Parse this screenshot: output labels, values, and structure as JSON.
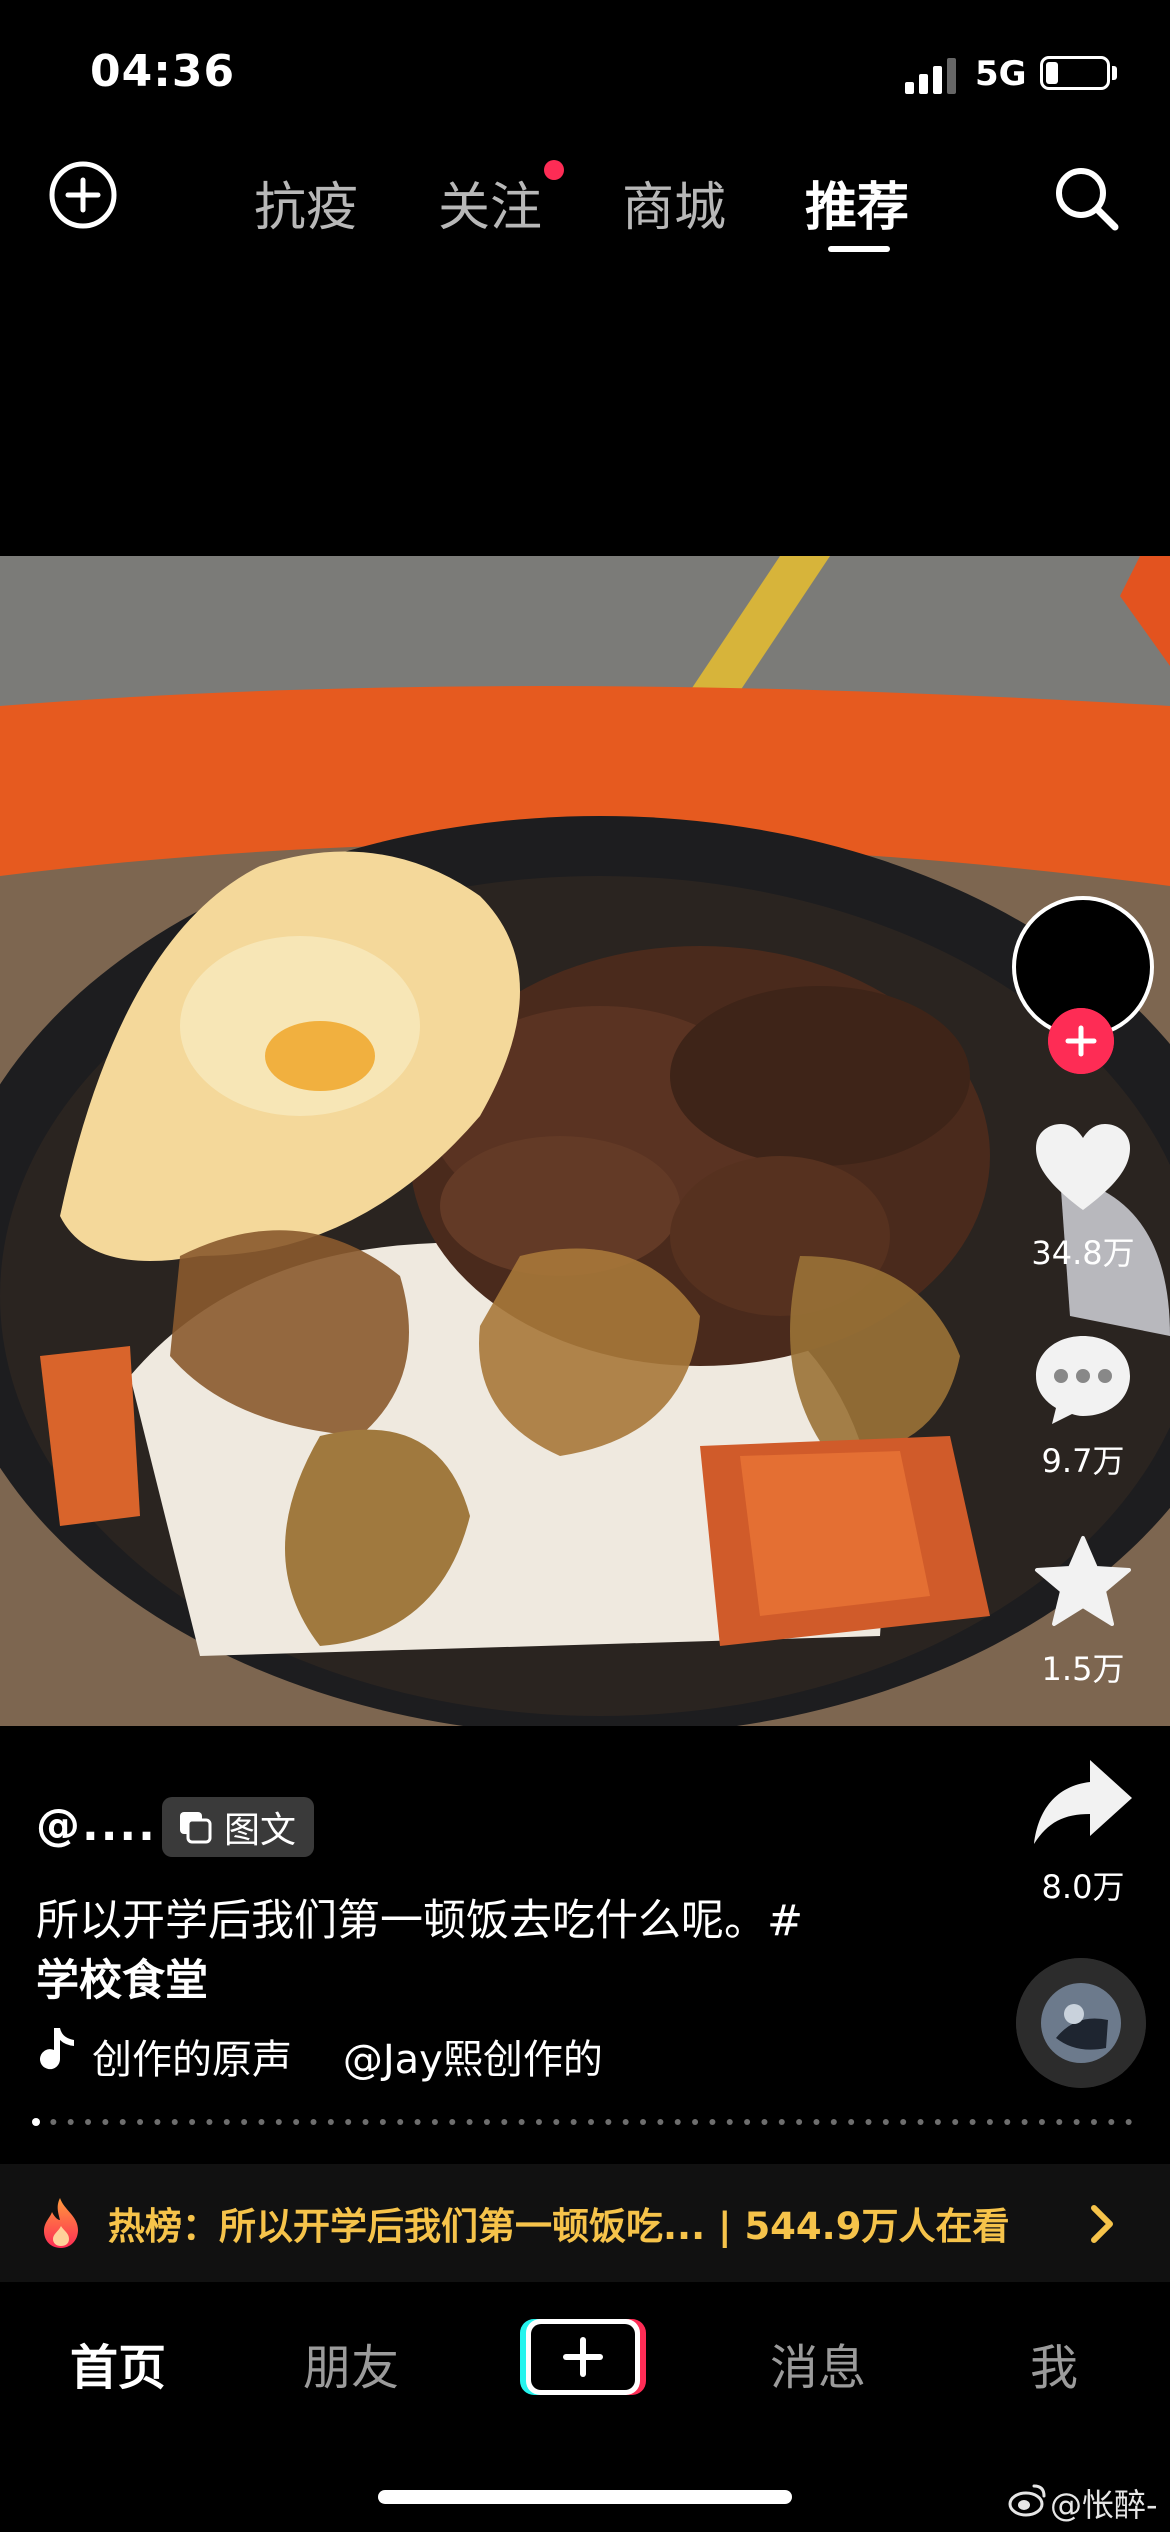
{
  "status": {
    "time": "04:36",
    "network": "5G"
  },
  "top_tabs": [
    "抗疫",
    "关注",
    "商城",
    "推荐"
  ],
  "post": {
    "author": "@....",
    "type_badge": "图文",
    "caption_line1": "所以开学后我们第一顿饭去吃什么呢。#",
    "caption_tag": "学校食堂",
    "music": "创作的原声    @Jay熙创作的"
  },
  "actions": {
    "likes": "34.8万",
    "comments": "9.7万",
    "favorites": "1.5万",
    "shares": "8.0万"
  },
  "hot": {
    "text": "热榜：所以开学后我们第一顿饭吃... | 544.9万人在看"
  },
  "bottom_tabs": [
    "首页",
    "朋友",
    "消息",
    "我"
  ],
  "watermark": "@怅醉-",
  "colors": {
    "accent_red": "#fe2c55",
    "hot_yellow": "#f6c34a",
    "cyan": "#25f4ee"
  }
}
